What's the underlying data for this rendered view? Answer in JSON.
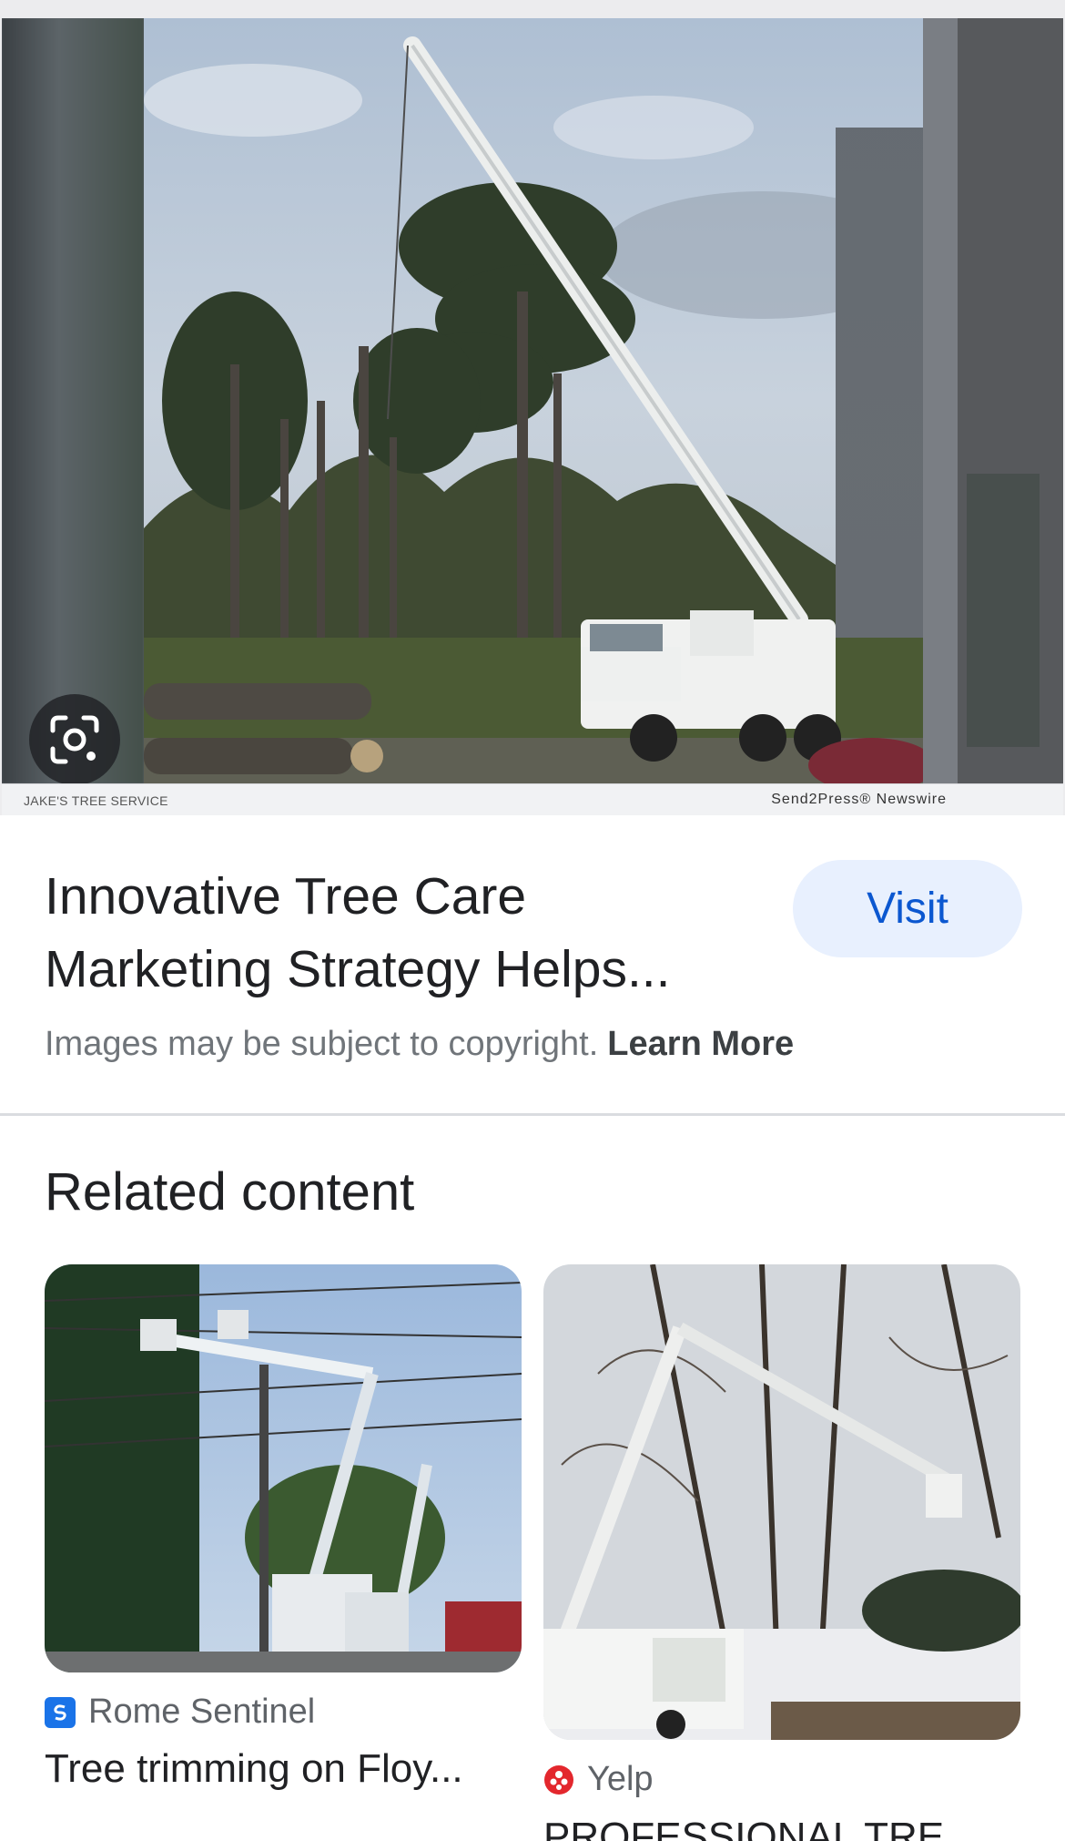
{
  "hero": {
    "credit_left": "JAKE'S TREE SERVICE",
    "credit_right": "Send2Press® Newswire",
    "lens_icon": "google-lens-icon"
  },
  "result": {
    "title": "Innovative Tree Care Marketing Strategy Helps...",
    "visit_label": "Visit",
    "copyright_text": "Images may be subject to copyright.",
    "learn_more_label": "Learn More"
  },
  "related": {
    "heading": "Related content",
    "cards": [
      {
        "source": "Rome Sentinel",
        "title": "Tree trimming on Floy...",
        "favicon": "rome-sentinel-favicon",
        "favicon_color": "#1a73e8"
      },
      {
        "source": "Yelp",
        "title": "PROFESSIONAL TRE",
        "favicon": "yelp-favicon",
        "favicon_color": "#e3272d"
      }
    ]
  },
  "colors": {
    "accent": "#0b57d0",
    "visit_bg": "#e8f0fe",
    "text_primary": "#202124",
    "text_secondary": "#70757a"
  }
}
